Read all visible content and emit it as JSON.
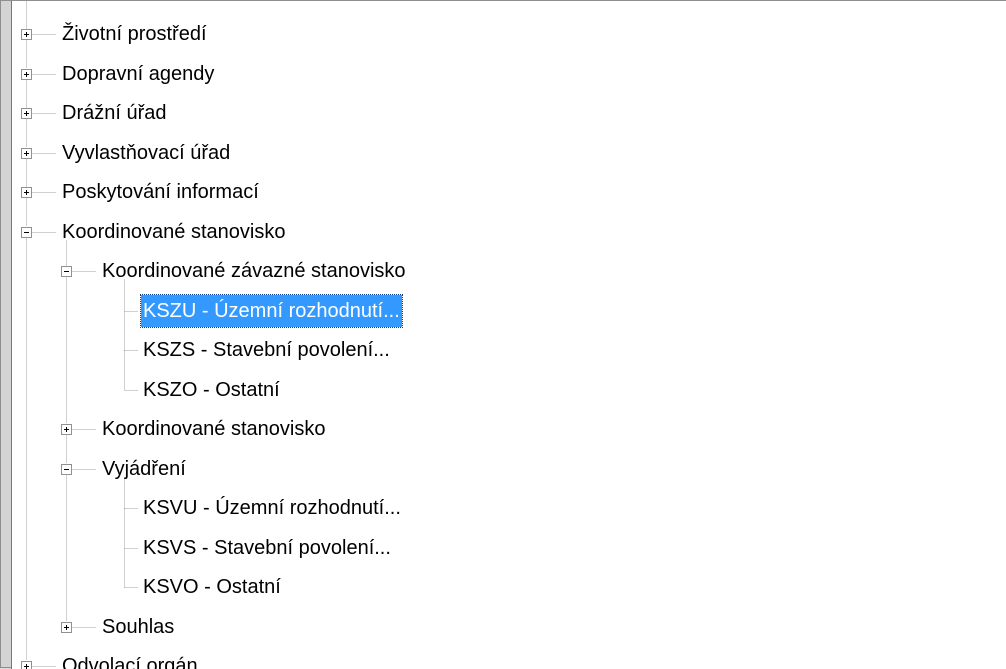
{
  "tree": {
    "nodes": [
      {
        "label": "Životní prostředí",
        "level": 0,
        "expander": "plus"
      },
      {
        "label": "Dopravní agendy",
        "level": 0,
        "expander": "plus"
      },
      {
        "label": "Drážní úřad",
        "level": 0,
        "expander": "plus"
      },
      {
        "label": "Vyvlastňovací úřad",
        "level": 0,
        "expander": "plus"
      },
      {
        "label": "Poskytování informací",
        "level": 0,
        "expander": "plus"
      },
      {
        "label": "Koordinované stanovisko",
        "level": 0,
        "expander": "minus"
      },
      {
        "label": "Koordinované závazné stanovisko",
        "level": 1,
        "expander": "minus"
      },
      {
        "label": "KSZU - Územní rozhodnutí...",
        "level": 2,
        "expander": "none",
        "selected": true
      },
      {
        "label": "KSZS - Stavební povolení...",
        "level": 2,
        "expander": "none"
      },
      {
        "label": "KSZO - Ostatní",
        "level": 2,
        "expander": "none"
      },
      {
        "label": "Koordinované stanovisko",
        "level": 1,
        "expander": "plus"
      },
      {
        "label": "Vyjádření",
        "level": 1,
        "expander": "minus"
      },
      {
        "label": "KSVU - Územní rozhodnutí...",
        "level": 2,
        "expander": "none"
      },
      {
        "label": "KSVS - Stavební povolení...",
        "level": 2,
        "expander": "none"
      },
      {
        "label": "KSVO - Ostatní",
        "level": 2,
        "expander": "none"
      },
      {
        "label": "Souhlas",
        "level": 1,
        "expander": "plus"
      },
      {
        "label": "Odvolací orgán",
        "level": 0,
        "expander": "plus"
      }
    ]
  },
  "colors": {
    "selection_bg": "#3399ff",
    "selection_text": "#ffffff",
    "guide_lines": "#a0a0a0"
  }
}
